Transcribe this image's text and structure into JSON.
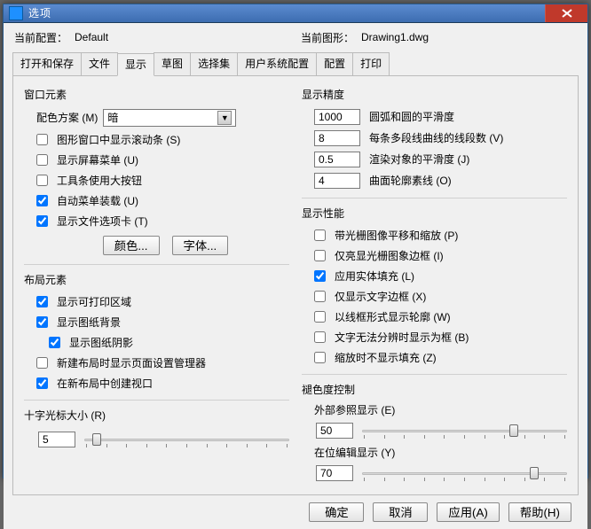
{
  "window": {
    "title": "选项"
  },
  "header": {
    "config_label": "当前配置：",
    "config_value": "Default",
    "drawing_label": "当前图形：",
    "drawing_value": "Drawing1.dwg"
  },
  "tabs": [
    "打开和保存",
    "文件",
    "显示",
    "草图",
    "选择集",
    "用户系统配置",
    "配置",
    "打印"
  ],
  "active_tab": "显示",
  "left": {
    "section1": "窗口元素",
    "color_scheme_label": "配色方案 (M)",
    "color_scheme_value": "暗",
    "cb1": "图形窗口中显示滚动条 (S)",
    "cb2": "显示屏幕菜单 (U)",
    "cb3": "工具条使用大按钮",
    "cb4": "自动菜单装载 (U)",
    "cb5": "显示文件选项卡 (T)",
    "btn_color": "颜色...",
    "btn_font": "字体...",
    "section2": "布局元素",
    "cb6": "显示可打印区域",
    "cb7": "显示图纸背景",
    "cb8": "显示图纸阴影",
    "cb9": "新建布局时显示页面设置管理器",
    "cb10": "在新布局中创建视口",
    "section3": "十字光标大小 (R)",
    "crosshair_value": "5"
  },
  "right": {
    "section1": "显示精度",
    "p1_val": "1000",
    "p1_lbl": "圆弧和圆的平滑度",
    "p2_val": "8",
    "p2_lbl": "每条多段线曲线的线段数 (V)",
    "p3_val": "0.5",
    "p3_lbl": "渲染对象的平滑度 (J)",
    "p4_val": "4",
    "p4_lbl": "曲面轮廓素线 (O)",
    "section2": "显示性能",
    "cb1": "带光栅图像平移和缩放 (P)",
    "cb2": "仅亮显光栅图象边框 (I)",
    "cb3": "应用实体填充 (L)",
    "cb4": "仅显示文字边框 (X)",
    "cb5": "以线框形式显示轮廓 (W)",
    "cb6": "文字无法分辨时显示为框 (B)",
    "cb7": "缩放时不显示填充 (Z)",
    "section3": "褪色度控制",
    "xref_label": "外部参照显示 (E)",
    "xref_value": "50",
    "inplace_label": "在位编辑显示 (Y)",
    "inplace_value": "70"
  },
  "footer": {
    "ok": "确定",
    "cancel": "取消",
    "apply": "应用(A)",
    "help": "帮助(H)"
  }
}
